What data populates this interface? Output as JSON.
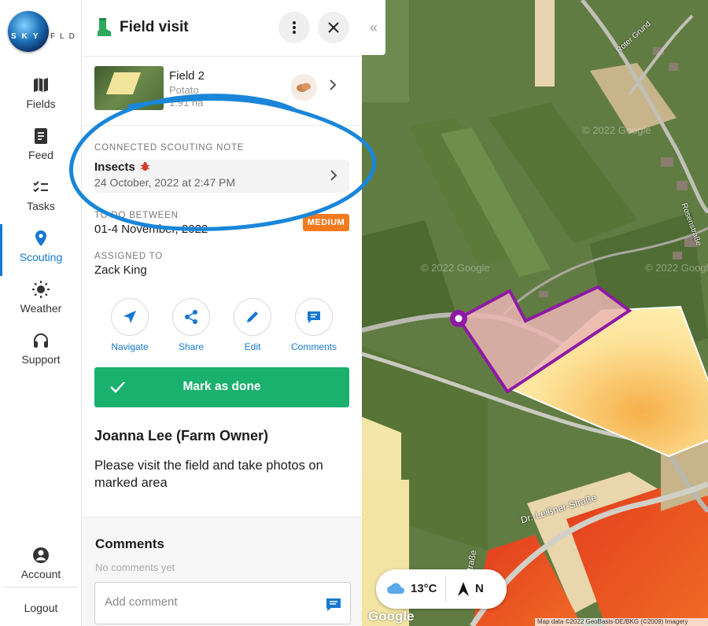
{
  "app": {
    "logo_letters_left": "SKY",
    "logo_letters_right": "FLD"
  },
  "nav": {
    "items": [
      {
        "label": "Fields",
        "icon": "map-icon"
      },
      {
        "label": "Feed",
        "icon": "feed-icon"
      },
      {
        "label": "Tasks",
        "icon": "tasks-icon"
      },
      {
        "label": "Scouting",
        "icon": "location-pin-icon",
        "active": true
      },
      {
        "label": "Weather",
        "icon": "sun-icon"
      },
      {
        "label": "Support",
        "icon": "headset-icon"
      }
    ],
    "account_label": "Account",
    "logout_label": "Logout",
    "active_color": "#1678d2"
  },
  "panel": {
    "title": "Field visit",
    "field": {
      "name": "Field 2",
      "crop": "Potato",
      "area": "1.91 ha"
    },
    "connected_label": "CONNECTED SCOUTING NOTE",
    "note": {
      "title": "Insects",
      "date": "24 October, 2022 at 2:47 PM"
    },
    "todo_label": "TO DO BETWEEN",
    "todo_value": "01-4 November, 2022",
    "priority": "MEDIUM",
    "priority_color": "#f47a1f",
    "assigned_label": "ASSIGNED TO",
    "assigned_value": "Zack King",
    "actions": [
      {
        "label": "Navigate",
        "icon": "navigate-arrow-icon"
      },
      {
        "label": "Share",
        "icon": "share-icon"
      },
      {
        "label": "Edit",
        "icon": "pencil-icon"
      },
      {
        "label": "Comments",
        "icon": "comment-icon"
      }
    ],
    "done_button": "Mark as done",
    "done_color": "#1ab06e",
    "author": "Joanna Lee (Farm Owner)",
    "description": "Please visit the field and take photos on marked area",
    "comments_heading": "Comments",
    "no_comments": "No comments yet",
    "comment_placeholder": "Add comment"
  },
  "map": {
    "weather_temp": "13°C",
    "compass": "N",
    "street_labels": [
      "Roter Grund",
      "Rosenstraße",
      "Dr.-Leißner-Straße",
      "Leißner-Straße"
    ],
    "watermark": "© 2022 Google",
    "google": "Google",
    "attribution": "Map data ©2022 GeoBasis-DE/BKG (©2009) Imagery"
  }
}
